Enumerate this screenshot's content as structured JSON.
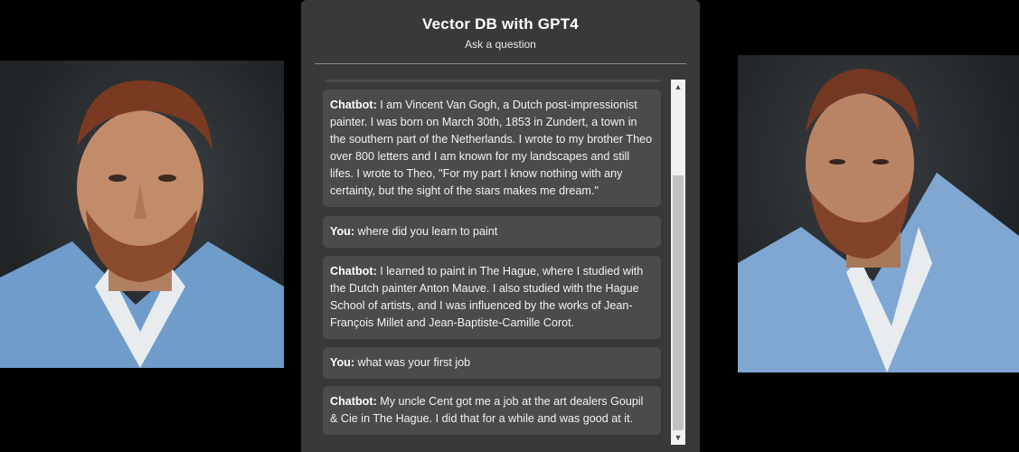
{
  "header": {
    "title": "Vector DB with GPT4",
    "subtitle": "Ask a question"
  },
  "messages": [
    {
      "role": "Chatbot:",
      "text": " I am Vincent Van Gogh, a Dutch post-impressionist painter. I was born on March 30th, 1853 in Zundert, a town in the southern part of the Netherlands. I wrote to my brother Theo over 800 letters and I am known for my landscapes and still lifes. I wrote to Theo, \"For my part I know nothing with any certainty, but the sight of the stars makes me dream.\""
    },
    {
      "role": "You:",
      "text": " where did you learn to paint"
    },
    {
      "role": "Chatbot:",
      "text": " I learned to paint in The Hague, where I studied with the Dutch painter Anton Mauve. I also studied with the Hague School of artists, and I was influenced by the works of Jean-François Millet and Jean-Baptiste-Camille Corot."
    },
    {
      "role": "You:",
      "text": " what was your first job"
    },
    {
      "role": "Chatbot:",
      "text": " My uncle Cent got me a job at the art dealers Goupil & Cie in The Hague. I did that for a while and was good at it."
    }
  ],
  "scrollbar": {
    "up_icon": "arrow-up-icon",
    "down_icon": "arrow-down-icon",
    "thumb_position": 0.72
  },
  "images": {
    "left": "van-gogh-portrait-front",
    "right": "van-gogh-portrait-side"
  }
}
